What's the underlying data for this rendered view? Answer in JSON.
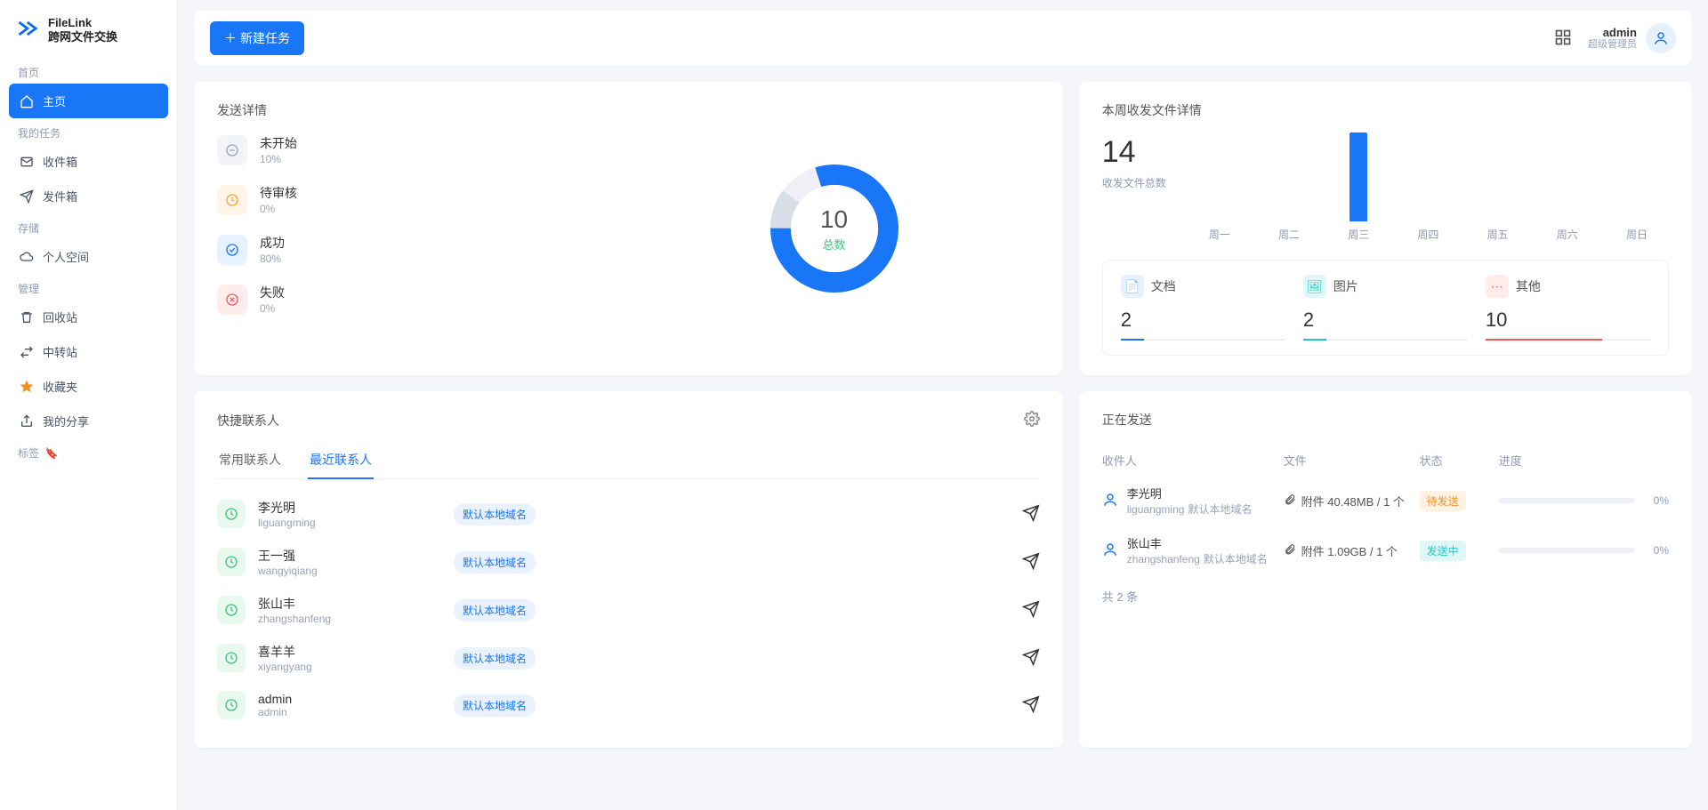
{
  "brand": {
    "name": "FileLink",
    "subtitle": "跨网文件交换"
  },
  "topbar": {
    "new_task": "新建任务"
  },
  "user": {
    "name": "admin",
    "role": "超级管理员"
  },
  "nav": {
    "groups": {
      "home": "首页",
      "tasks": "我的任务",
      "storage": "存储",
      "manage": "管理",
      "tags": "标签"
    },
    "items": {
      "home": "主页",
      "inbox": "收件箱",
      "outbox": "发件箱",
      "personal": "个人空间",
      "recycle": "回收站",
      "transfer": "中转站",
      "favorite": "收藏夹",
      "share": "我的分享"
    }
  },
  "send_details": {
    "title": "发送详情",
    "donut_total": "10",
    "donut_label": "总数",
    "items": [
      {
        "label": "未开始",
        "pct": "10%"
      },
      {
        "label": "待审核",
        "pct": "0%"
      },
      {
        "label": "成功",
        "pct": "80%"
      },
      {
        "label": "失败",
        "pct": "0%"
      }
    ]
  },
  "chart_data": {
    "type": "donut",
    "title": "发送详情",
    "total": 10,
    "slices": [
      {
        "name": "未开始",
        "value": 1,
        "pct": 10,
        "color": "#d9dde5"
      },
      {
        "name": "待审核",
        "value": 0,
        "pct": 0,
        "color": "#f7a43b"
      },
      {
        "name": "成功",
        "value": 8,
        "pct": 80,
        "color": "#1976f6"
      },
      {
        "name": "失败",
        "value": 0,
        "pct": 0,
        "color": "#f05b5b"
      }
    ]
  },
  "week": {
    "title": "本周收发文件详情",
    "total": "14",
    "subtitle": "收发文件总数",
    "bars": [
      {
        "label": "周一",
        "value": 0
      },
      {
        "label": "周二",
        "value": 0
      },
      {
        "label": "周三",
        "value": 14
      },
      {
        "label": "周四",
        "value": 0
      },
      {
        "label": "周五",
        "value": 0
      },
      {
        "label": "周六",
        "value": 0
      },
      {
        "label": "周日",
        "value": 0
      }
    ],
    "categories": [
      {
        "name": "文档",
        "value": "2",
        "color": "blue"
      },
      {
        "name": "图片",
        "value": "2",
        "color": "cyan"
      },
      {
        "name": "其他",
        "value": "10",
        "color": "red"
      }
    ]
  },
  "contacts": {
    "title": "快捷联系人",
    "tabs": {
      "frequent": "常用联系人",
      "recent": "最近联系人"
    },
    "domain_tag": "默认本地域名",
    "list": [
      {
        "name": "李光明",
        "user": "liguangming"
      },
      {
        "name": "王一强",
        "user": "wangyiqiang"
      },
      {
        "name": "张山丰",
        "user": "zhangshanfeng"
      },
      {
        "name": "喜羊羊",
        "user": "xiyangyang"
      },
      {
        "name": "admin",
        "user": "admin"
      }
    ]
  },
  "sending": {
    "title": "正在发送",
    "columns": {
      "rcpt": "收件人",
      "file": "文件",
      "status": "状态",
      "progress": "进度"
    },
    "rows": [
      {
        "name": "李光明",
        "user": "liguangming",
        "domain": "默认本地域名",
        "file": "附件 40.48MB / 1 个",
        "status": "待发送",
        "status_cls": "pending",
        "pct": "0%"
      },
      {
        "name": "张山丰",
        "user": "zhangshanfeng",
        "domain": "默认本地域名",
        "file": "附件 1.09GB / 1 个",
        "status": "发送中",
        "status_cls": "sending",
        "pct": "0%"
      }
    ],
    "total": "共 2 条"
  }
}
